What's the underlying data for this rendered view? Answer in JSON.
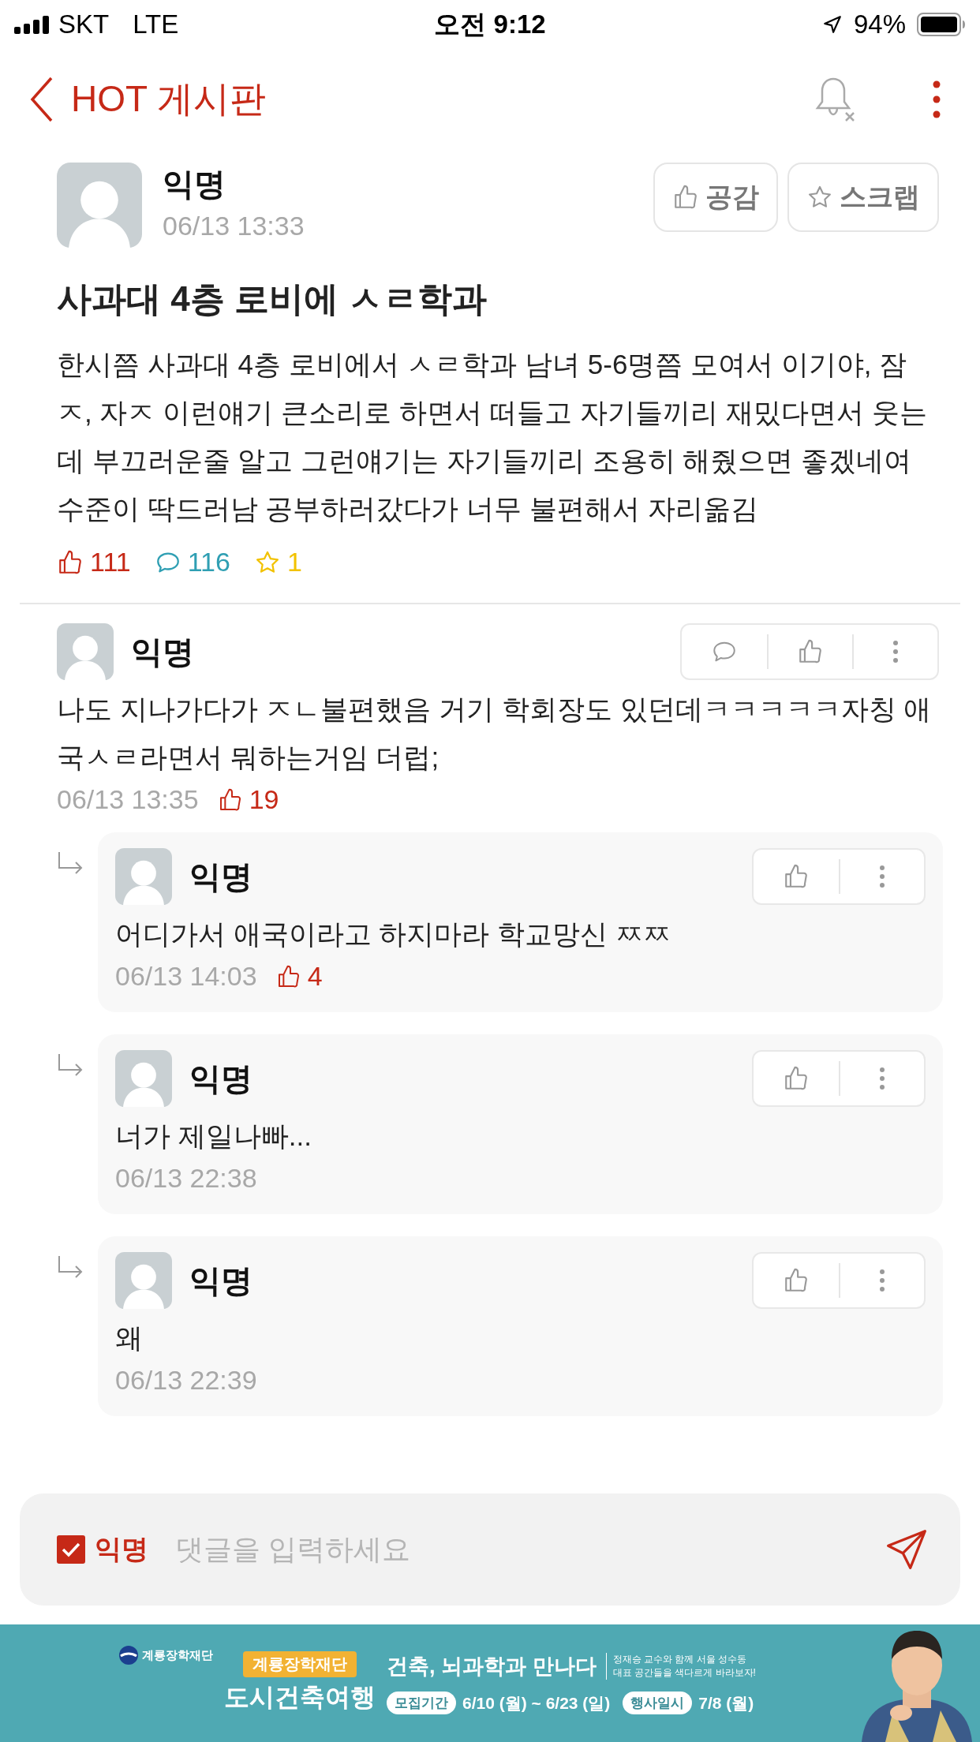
{
  "status_bar": {
    "carrier": "SKT",
    "network": "LTE",
    "time": "오전 9:12",
    "battery": "94%"
  },
  "header": {
    "back_label": "HOT 게시판"
  },
  "post": {
    "author": "익명",
    "date": "06/13 13:33",
    "buttons": [
      {
        "kind": "like",
        "label": "공감"
      },
      {
        "kind": "scrap",
        "label": "스크랩"
      }
    ],
    "title": "사과대 4층 로비에 ㅅㄹ학과",
    "body": "한시쯤 사과대 4층 로비에서 ㅅㄹ학과 남녀 5-6명쯤 모여서 이기야, 잠ㅈ, 자ㅈ 이런얘기 큰소리로 하면서 떠들고 자기들끼리 재밌다면서 웃는데 부끄러운줄 알고 그런얘기는 자기들끼리 조용히 해줬으면 좋겠네여 수준이 딱드러남 공부하러갔다가 너무 불편해서 자리옮김",
    "likes": "111",
    "comments": "116",
    "scraps": "1"
  },
  "comments": [
    {
      "author": "익명",
      "text": "나도 지나가다가 ㅈㄴ불편했음 거기 학회장도 있던데ㅋㅋㅋㅋㅋ자칭 애국ㅅㄹ라면서 뭐하는거임 더럽;",
      "date": "06/13 13:35",
      "likes": "19",
      "replies": [
        {
          "author": "익명",
          "text": "어디가서 애국이라고 하지마라 학교망신 ㅉㅉ",
          "date": "06/13 14:03",
          "likes": "4"
        },
        {
          "author": "익명",
          "text": "너가 제일나빠...",
          "date": "06/13 22:38"
        },
        {
          "author": "익명",
          "text": "왜",
          "date": "06/13 22:39"
        }
      ]
    }
  ],
  "comment_input": {
    "anonymous_label": "익명",
    "anonymous_checked": true,
    "placeholder": "댓글을 입력하세요"
  },
  "ad": {
    "logo": "계룡장학재단",
    "badge": "계룡장학재단",
    "title": "도시건축여행",
    "headline": "건축, 뇌과학과 만나다",
    "blurb": [
      "정재승 교수와 함께 서울 성수동",
      "대표 공간들을 색다르게 바라보자!"
    ],
    "period_label": "모집기간",
    "period": "6/10 (월) ~ 6/23 (일)",
    "event_label": "행사일시",
    "event_date": "7/8 (월)"
  }
}
